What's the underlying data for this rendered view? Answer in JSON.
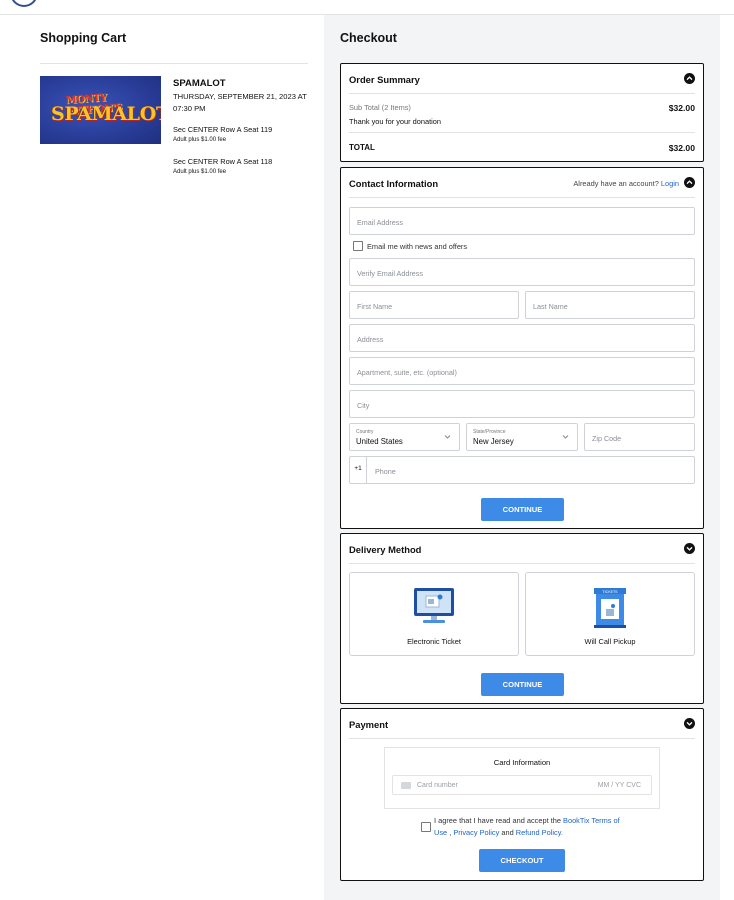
{
  "cart": {
    "title": "Shopping Cart",
    "event_name": "SPAMALOT",
    "event_date": "THURSDAY, SEPTEMBER 21, 2023 AT 07:30 PM",
    "poster_line1": "MONTY PYTHON'S",
    "poster_line2": "SPAMALOT",
    "seats": [
      {
        "seat": "Sec CENTER Row A Seat 119",
        "fee": "Adult plus $1.00 fee"
      },
      {
        "seat": "Sec CENTER Row A Seat 118",
        "fee": "Adult plus $1.00 fee"
      }
    ]
  },
  "checkout": {
    "title": "Checkout",
    "order_summary": {
      "heading": "Order Summary",
      "subtotal_label": "Sub Total (2 Items)",
      "subtotal_value": "$32.00",
      "donation_text": "Thank you for your donation",
      "total_label": "TOTAL",
      "total_value": "$32.00"
    },
    "contact": {
      "heading": "Contact Information",
      "account_prompt": "Already have an account?",
      "login_label": "Login",
      "email_placeholder": "Email Address",
      "newsletter_label": "Email me with news and offers",
      "verify_email_placeholder": "Verify Email Address",
      "first_name_placeholder": "First Name",
      "last_name_placeholder": "Last Name",
      "address_placeholder": "Address",
      "apartment_placeholder": "Apartment, suite, etc. (optional)",
      "city_placeholder": "City",
      "country_label": "Country",
      "country_value": "United States",
      "state_label": "State/Province",
      "state_value": "New Jersey",
      "zip_placeholder": "Zip Code",
      "phone_prefix": "+1",
      "phone_placeholder": "Phone",
      "continue_label": "CONTINUE"
    },
    "delivery": {
      "heading": "Delivery Method",
      "options": [
        {
          "label": "Electronic Ticket",
          "icon": "computer-icon"
        },
        {
          "label": "Will Call Pickup",
          "icon": "ticket-booth-icon",
          "icon_text": "TICKETS"
        }
      ],
      "continue_label": "CONTINUE"
    },
    "payment": {
      "heading": "Payment",
      "card_info_title": "Card Information",
      "card_number_placeholder": "Card number",
      "expiry_cvc_placeholder": "MM / YY  CVC",
      "agree_text_prefix": "I agree that I have read and accept the",
      "booktix_terms_link": "BookTix Terms of Use",
      "privacy_link": "Privacy Policy",
      "and_text": "and",
      "refund_link": "Refund Policy.",
      "checkout_label": "CHECKOUT"
    }
  },
  "colors": {
    "accent": "#3d8be6",
    "link": "#1f63c6",
    "panel_background": "#f3f4f6"
  }
}
